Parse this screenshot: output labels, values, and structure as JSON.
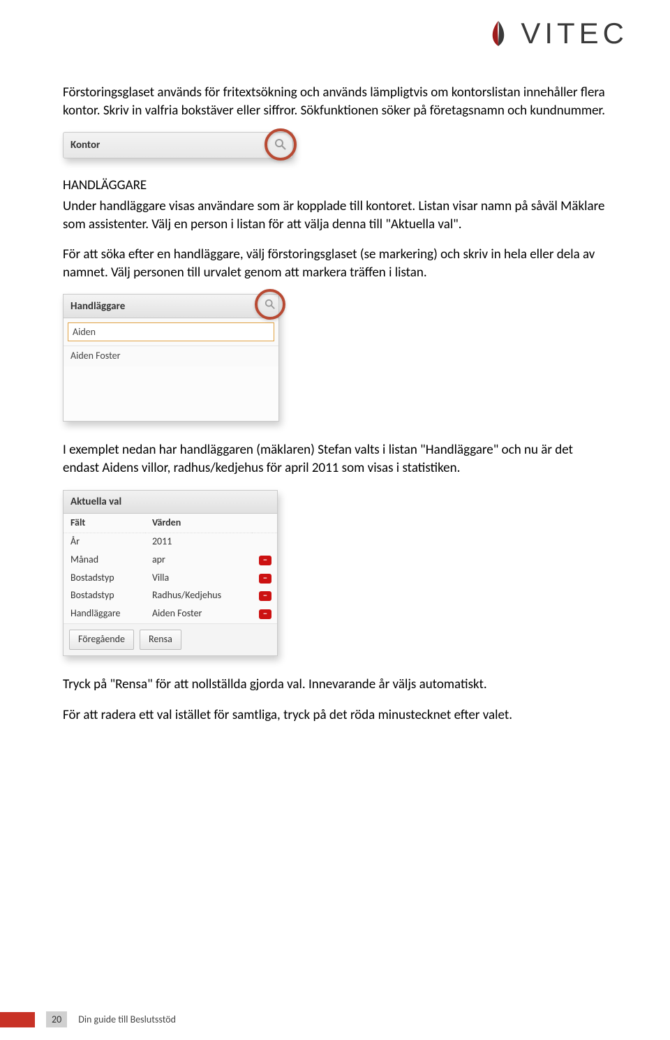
{
  "brand": {
    "name": "VITEC"
  },
  "body": {
    "p1": "Förstoringsglaset används för fritextsökning och används lämpligtvis om kontorslistan innehåller flera kontor. Skriv in valfria bokstäver eller siffror. Sökfunktionen söker på företagsnamn och kundnummer.",
    "kontor_label": "Kontor",
    "h3": "HANDLÄGGARE",
    "p2": "Under handläggare visas användare som är kopplade till kontoret. Listan visar namn på såväl Mäklare som assistenter. Välj en person i listan för att välja denna till \"Aktuella val\".",
    "p3": "För att söka efter en handläggare, välj förstoringsglaset (se markering) och skriv in hela eller dela av namnet. Välj personen till urvalet genom att markera träffen i listan.",
    "handl_panel": {
      "title": "Handläggare",
      "search_value": "Aiden",
      "result": "Aiden Foster"
    },
    "p4": "I exemplet nedan har handläggaren (mäklaren) Stefan valts i listan \"Handläggare\" och nu är det endast Aidens villor, radhus/kedjehus för april 2011 som visas i statistiken.",
    "aktuella": {
      "title": "Aktuella val",
      "col1": "Fält",
      "col2": "Värden",
      "rows": [
        {
          "field": "År",
          "value": "2011",
          "minus": false
        },
        {
          "field": "Månad",
          "value": "apr",
          "minus": true
        },
        {
          "field": "Bostadstyp",
          "value": "Villa",
          "minus": true
        },
        {
          "field": "Bostadstyp",
          "value": "Radhus/Kedjehus",
          "minus": true
        },
        {
          "field": "Handläggare",
          "value": "Aiden Foster",
          "minus": true
        }
      ],
      "btn_prev": "Föregående",
      "btn_clear": "Rensa"
    },
    "p5": "Tryck på \"Rensa\" för att nollställda gjorda val. Innevarande år väljs automatiskt.",
    "p6": "För att radera ett val istället för samtliga, tryck på det röda minustecknet efter valet."
  },
  "footer": {
    "page": "20",
    "title": "Din guide till Beslutsstöd"
  }
}
